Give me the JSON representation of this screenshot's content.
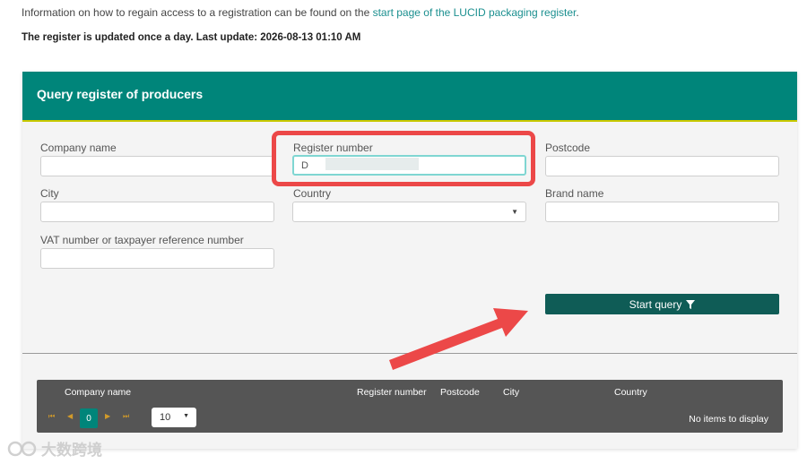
{
  "info": {
    "prefix": "Information on how to regain access to a registration can be found on the ",
    "link": "start page of the LUCID packaging register",
    "suffix": "."
  },
  "update_text": "The register is updated once a day. Last update: 2026-08-13 01:10 AM",
  "panel": {
    "title": "Query register of producers"
  },
  "form": {
    "company_name": {
      "label": "Company name",
      "value": ""
    },
    "register_number": {
      "label": "Register number",
      "value": "D"
    },
    "postcode": {
      "label": "Postcode",
      "value": ""
    },
    "city": {
      "label": "City",
      "value": ""
    },
    "country": {
      "label": "Country",
      "value": ""
    },
    "brand_name": {
      "label": "Brand name",
      "value": ""
    },
    "vat": {
      "label": "VAT number or taxpayer reference number",
      "value": ""
    }
  },
  "query_button": {
    "label": "Start query",
    "icon": "filter-icon"
  },
  "grid": {
    "columns": [
      "Company name",
      "Register number",
      "Postcode",
      "City",
      "Country"
    ],
    "pager": {
      "first": "⏮",
      "prev": "◀",
      "current": "0",
      "next": "▶",
      "last": "⏭",
      "page_size": "10"
    },
    "empty_text": "No items to display"
  },
  "colors": {
    "header": "#00857a",
    "button": "#0f5c56",
    "highlight": "#ec4848",
    "link": "#1a8f8f"
  },
  "watermark": "大数跨境"
}
